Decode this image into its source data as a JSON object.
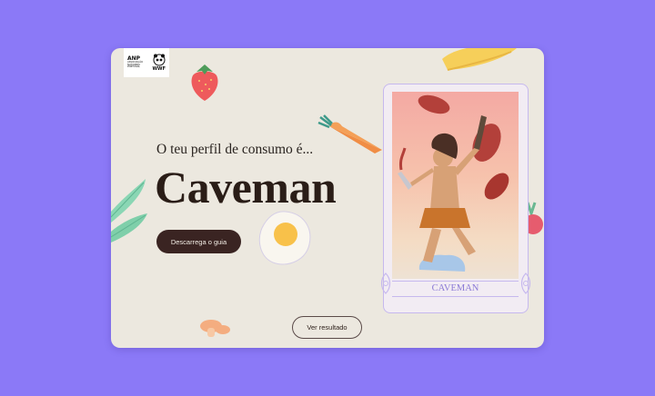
{
  "logos": {
    "anp": "ANP",
    "anp_sub": "ASSOCIAÇÃO NATUREZA PORTUGAL",
    "wwf": "WWF"
  },
  "hero": {
    "subtitle": "O teu perfil de consumo é...",
    "title": "Caveman",
    "download_button": "Descarrega o guia",
    "result_button": "Ver resultado"
  },
  "card": {
    "label": "CAVEMAN"
  },
  "colors": {
    "background": "#8b79f7",
    "panel": "#ece8df",
    "button_dark": "#3a2422",
    "card_accent": "#8b7ad6"
  },
  "icons": [
    "strawberry-icon",
    "carrot-icon",
    "fried-egg-icon",
    "mushroom-icon",
    "leaf-icon",
    "banana-icon",
    "panda-icon"
  ]
}
